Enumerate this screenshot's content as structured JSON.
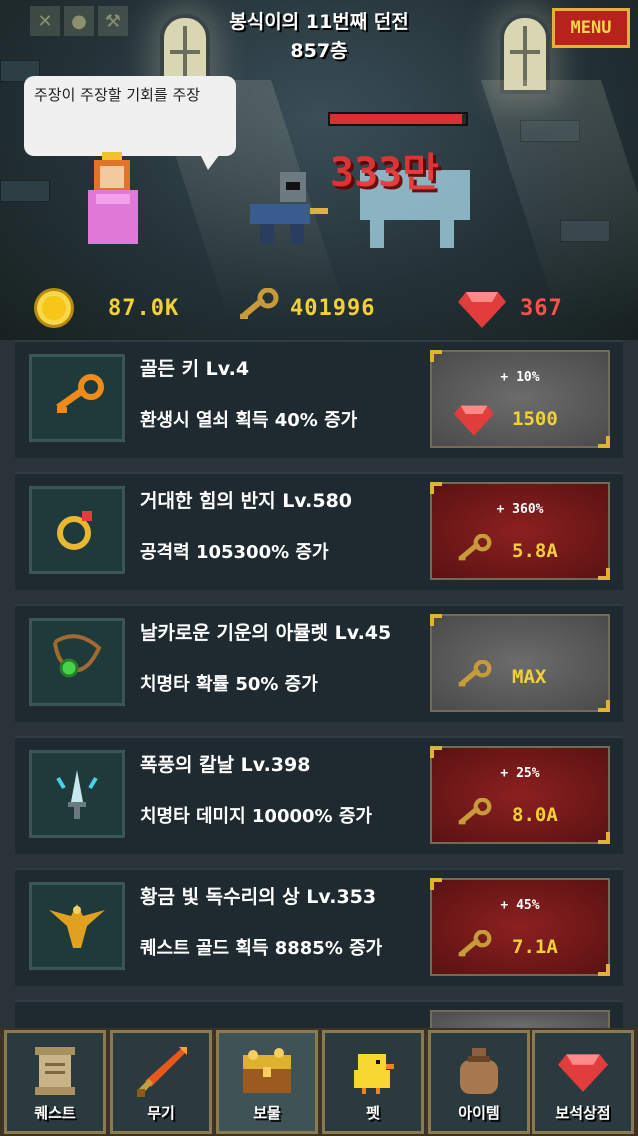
{
  "header": {
    "dungeon_title": "봉식이의 11번째 던전",
    "floor": "857층",
    "menu_label": "MENU"
  },
  "speech_bubble": "주장이 주장할 기회를 주장",
  "battle": {
    "damage_text": "333만",
    "monster_hp_fraction": 0.97
  },
  "currency": {
    "gold": "87.0K",
    "keys": "401996",
    "gems": "367"
  },
  "items": [
    {
      "name": "골든 키 Lv.4",
      "desc": "환생시 열쇠 획득 40% 증가",
      "increment": "+ 10%",
      "cost": "1500",
      "cost_currency": "gem",
      "button_state": "gray",
      "icon": "golden-key-icon"
    },
    {
      "name": "거대한 힘의 반지 Lv.580",
      "desc": "공격력 105300% 증가",
      "increment": "+ 360%",
      "cost": "5.8A",
      "cost_currency": "key",
      "button_state": "red",
      "icon": "ring-icon"
    },
    {
      "name": "날카로운 기운의 아뮬렛 Lv.45",
      "desc": "치명타 확률 50% 증가",
      "increment": "",
      "cost": "MAX",
      "cost_currency": "key",
      "button_state": "gray",
      "icon": "amulet-icon"
    },
    {
      "name": "폭풍의 칼날 Lv.398",
      "desc": "치명타 데미지 10000% 증가",
      "increment": "+ 25%",
      "cost": "8.0A",
      "cost_currency": "key",
      "button_state": "red",
      "icon": "storm-blade-icon"
    },
    {
      "name": "황금 빛 독수리의 상 Lv.353",
      "desc": "퀘스트 골드 획득 8885% 증가",
      "increment": "+ 45%",
      "cost": "7.1A",
      "cost_currency": "key",
      "button_state": "red",
      "icon": "golden-eagle-icon"
    }
  ],
  "tabs": [
    {
      "label": "퀘스트",
      "icon": "scroll-icon",
      "active": false
    },
    {
      "label": "무기",
      "icon": "sword-icon",
      "active": false
    },
    {
      "label": "보물",
      "icon": "treasure-chest-icon",
      "active": true
    },
    {
      "label": "펫",
      "icon": "chick-icon",
      "active": false
    },
    {
      "label": "아이템",
      "icon": "bag-icon",
      "active": false
    },
    {
      "label": "보석상점",
      "icon": "gem-icon",
      "active": false
    }
  ],
  "colors": {
    "gold_text": "#f2d03a",
    "gem_text": "#ff5050",
    "menu_bg": "#b8221c",
    "button_red": "#8c2020",
    "button_gray": "#5c5c5c"
  }
}
